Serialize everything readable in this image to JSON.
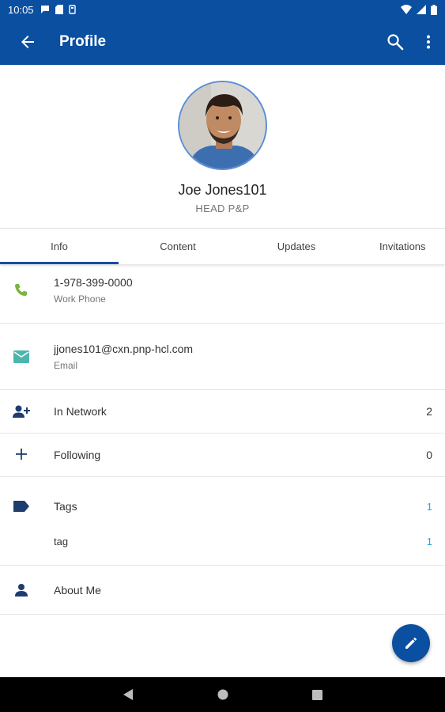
{
  "status_bar": {
    "time": "10:05"
  },
  "app_bar": {
    "title": "Profile"
  },
  "profile": {
    "name": "Joe Jones101",
    "role": "HEAD P&P"
  },
  "tabs": [
    {
      "label": "Info",
      "active": true
    },
    {
      "label": "Content",
      "active": false
    },
    {
      "label": "Updates",
      "active": false
    },
    {
      "label": "Invitations",
      "active": false
    }
  ],
  "info": {
    "phone": {
      "value": "1-978-399-0000",
      "label": "Work Phone",
      "icon": "phone-icon",
      "color": "#7cb342"
    },
    "email": {
      "value": "jjones101@cxn.pnp-hcl.com",
      "label": "Email",
      "icon": "email-icon",
      "color": "#4db6ac"
    },
    "network": {
      "label": "In Network",
      "count": "2",
      "icon": "person-add-icon"
    },
    "following": {
      "label": "Following",
      "count": "0",
      "icon": "plus-icon"
    },
    "tags": {
      "label": "Tags",
      "count": "1",
      "icon": "tag-icon",
      "items": [
        {
          "label": "tag",
          "count": "1"
        }
      ]
    },
    "about": {
      "label": "About Me",
      "icon": "person-icon"
    }
  },
  "colors": {
    "primary": "#0b4fa0",
    "accent_blue": "#2aa7d9",
    "icon_dark": "#1c3d6e"
  },
  "fab": {
    "icon": "pencil-icon"
  }
}
